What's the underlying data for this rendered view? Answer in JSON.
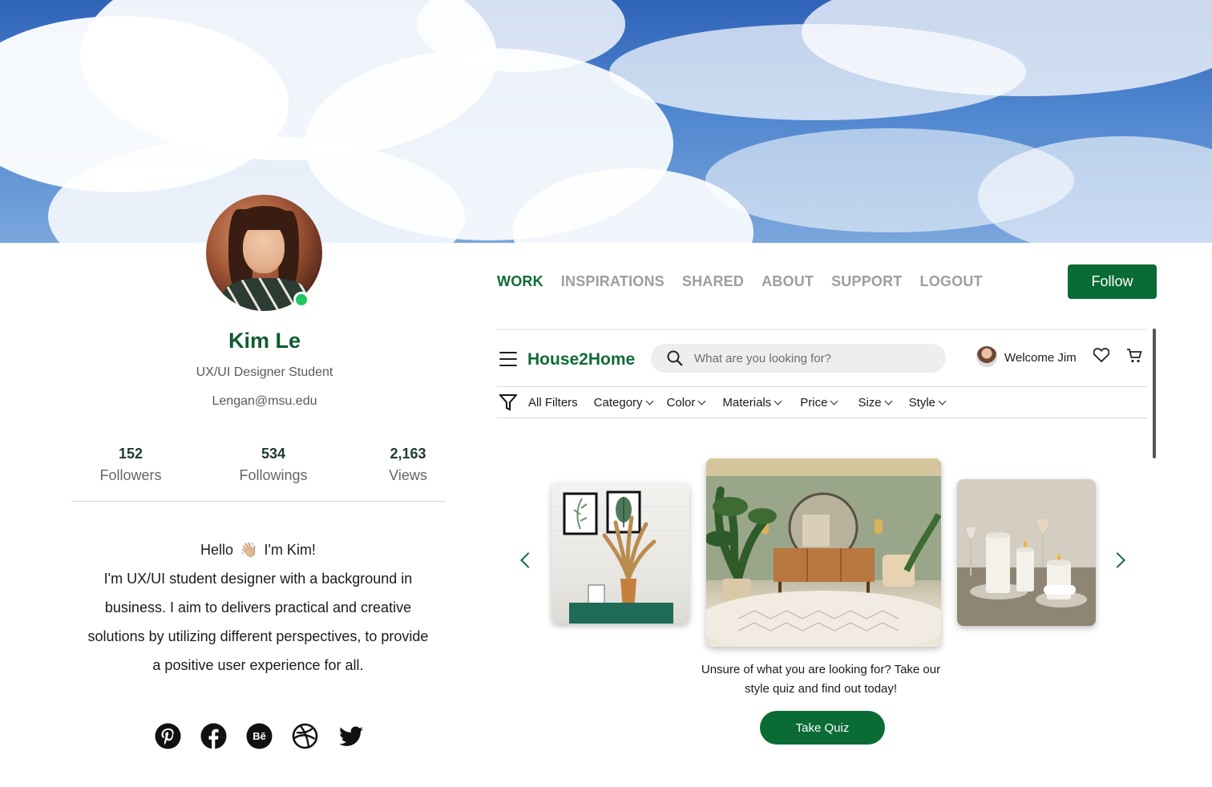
{
  "profile": {
    "name": "Kim Le",
    "role": "UX/UI Designer Student",
    "email": "Lengan@msu.edu",
    "stats": [
      {
        "value": "152",
        "label": "Followers"
      },
      {
        "value": "534",
        "label": "Followings"
      },
      {
        "value": "2,163",
        "label": "Views"
      }
    ],
    "bio": {
      "greeting_start": "Hello",
      "greeting_emoji": "👋🏼",
      "greeting_end": "I'm Kim!",
      "line1": "I'm UX/UI student designer with a background in",
      "line2": "business. I aim to delivers practical and creative",
      "line3": "solutions by utilizing different perspectives, to provide",
      "line4": "a positive user experience for all."
    },
    "socials": [
      "pinterest-icon",
      "facebook-icon",
      "behance-icon",
      "dribbble-icon",
      "twitter-icon"
    ]
  },
  "nav": {
    "items": [
      "WORK",
      "INSPIRATIONS",
      "SHARED",
      "ABOUT",
      "SUPPORT",
      "LOGOUT"
    ],
    "active": "WORK",
    "follow_label": "Follow"
  },
  "mock": {
    "brand": "House2Home",
    "search_placeholder": "What are you looking for?",
    "welcome": "Welcome Jim",
    "filters": [
      "All Filters",
      "Category",
      "Color",
      "Materials",
      "Price",
      "Size",
      "Style"
    ],
    "quiz_line1": "Unsure of what you are looking for? Take our",
    "quiz_line2": "style quiz and find out today!",
    "quiz_button": "Take Quiz"
  },
  "colors": {
    "brand_green": "#0a6b34",
    "nav_inactive": "#9aa09c",
    "online": "#22c55e"
  }
}
